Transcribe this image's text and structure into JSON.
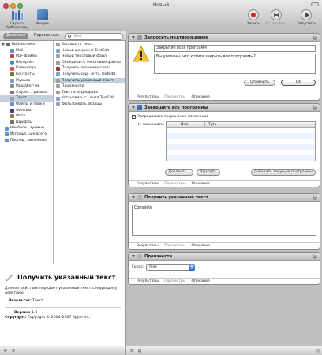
{
  "window": {
    "title": "Новый"
  },
  "toolbar": {
    "library_label": "Скрыть библиотеку",
    "media_label": "Медиа",
    "record_label": "Запись",
    "stop_label": "Остановить",
    "run_label": "Запустить"
  },
  "left_tabs": {
    "actions": "Действия",
    "variables": "Переменные",
    "search_placeholder": "Имя"
  },
  "library": {
    "items": [
      {
        "label": "Библиотека",
        "icon": "library-icon",
        "color": "#6b6b6b"
      },
      {
        "label": "Mail",
        "icon": "mail-icon",
        "color": "#5a8bd0"
      },
      {
        "label": "PDF-файлы",
        "icon": "pdf-icon",
        "color": "#c9403a"
      },
      {
        "label": "Интернет",
        "icon": "globe-icon",
        "color": "#3f7fc6"
      },
      {
        "label": "Календарь",
        "icon": "calendar-icon",
        "color": "#d9534f"
      },
      {
        "label": "Контакты",
        "icon": "contacts-icon",
        "color": "#8a6c3b"
      },
      {
        "label": "Музыка",
        "icon": "music-icon",
        "color": "#7a9ad0"
      },
      {
        "label": "Разработчик",
        "icon": "developer-icon",
        "color": "#8a8a8a"
      },
      {
        "label": "Служе...граммы",
        "icon": "utilities-icon",
        "color": "#7a7a7a"
      },
      {
        "label": "Текст",
        "icon": "text-icon",
        "color": "#a0a0a0"
      },
      {
        "label": "Файлы и папки",
        "icon": "folder-icon",
        "color": "#5b8fd0"
      },
      {
        "label": "Фильмы",
        "icon": "movies-icon",
        "color": "#3b3b8a"
      },
      {
        "label": "Фото",
        "icon": "photo-icon",
        "color": "#9a7a4a"
      },
      {
        "label": "Шрифты",
        "icon": "fonts-icon",
        "color": "#6e6e6e"
      }
    ],
    "smart_groups": [
      {
        "label": "Наиболе...зуемые",
        "icon": "smart-folder-icon",
        "color": "#5b8fd0"
      },
      {
        "label": "Использ...ще всего",
        "icon": "smart-folder-icon",
        "color": "#5b8fd0"
      },
      {
        "label": "Послед...авленные",
        "icon": "smart-folder-icon",
        "color": "#5b8fd0"
      }
    ]
  },
  "actions": {
    "items": [
      {
        "label": "Запросить текст",
        "icon": "text-action-icon",
        "color": "#a0a0a0"
      },
      {
        "label": "Новый документ TextEdit",
        "icon": "textedit-icon",
        "color": "#7fa3d8"
      },
      {
        "label": "Новый текстовый файл",
        "icon": "text-action-icon",
        "color": "#a0a0a0"
      },
      {
        "label": "Объединить текстовые файлы",
        "icon": "text-action-icon",
        "color": "#a0a0a0"
      },
      {
        "label": "Получить значение слова",
        "icon": "dictionary-icon",
        "color": "#9a3a2a"
      },
      {
        "label": "Получить сод...ента TextEdit",
        "icon": "textedit-icon",
        "color": "#7fa3d8"
      },
      {
        "label": "Получить указанный текст",
        "icon": "text-action-icon",
        "color": "#a0a0a0"
      },
      {
        "label": "Произнести",
        "icon": "speak-icon",
        "color": "#a0a0a0"
      },
      {
        "label": "Текст в аудиофайл",
        "icon": "audio-icon",
        "color": "#a0a0a0"
      },
      {
        "label": "Установить с...ента TextEdit",
        "icon": "textedit-icon",
        "color": "#7fa3d8"
      },
      {
        "label": "Фильтровать абзацы",
        "icon": "filter-icon",
        "color": "#a0a0a0"
      }
    ]
  },
  "description": {
    "title": "Получить указанный текст",
    "text": "Данное действие передает указанный текст следующему действию.",
    "result_label": "Результат:",
    "result_value": "Текст",
    "version_label": "Версия:",
    "version_value": "1.0",
    "copyright_label": "Copyright:",
    "copyright_value": "Copyright © 2004–2007 Apple Inc."
  },
  "footer_tabs": {
    "results": "Результаты",
    "options": "Параметры",
    "description": "Описание"
  },
  "cards": {
    "confirm": {
      "title": "Запросить подтверждение",
      "heading": "Закрытие всех программ",
      "message": "Вы уверены, что хотите закрыть все программы?",
      "cancel": "Отменить",
      "ok": "OK"
    },
    "quit_all": {
      "title": "Завершить все программы",
      "save_checkbox": "Запрашивать сохранение изменений",
      "dont_quit_label": "Не завершать:",
      "col_name": "Имя",
      "col_path": "Путь",
      "add_button": "Добавить...",
      "remove_button": "Удалить",
      "add_current_button": "Добавить текущие программы"
    },
    "get_text": {
      "title": "Получить указанный текст",
      "content": "Complete"
    },
    "speak": {
      "title": "Произнести",
      "voice_label": "Голос:",
      "voice_value": "Alex"
    }
  }
}
